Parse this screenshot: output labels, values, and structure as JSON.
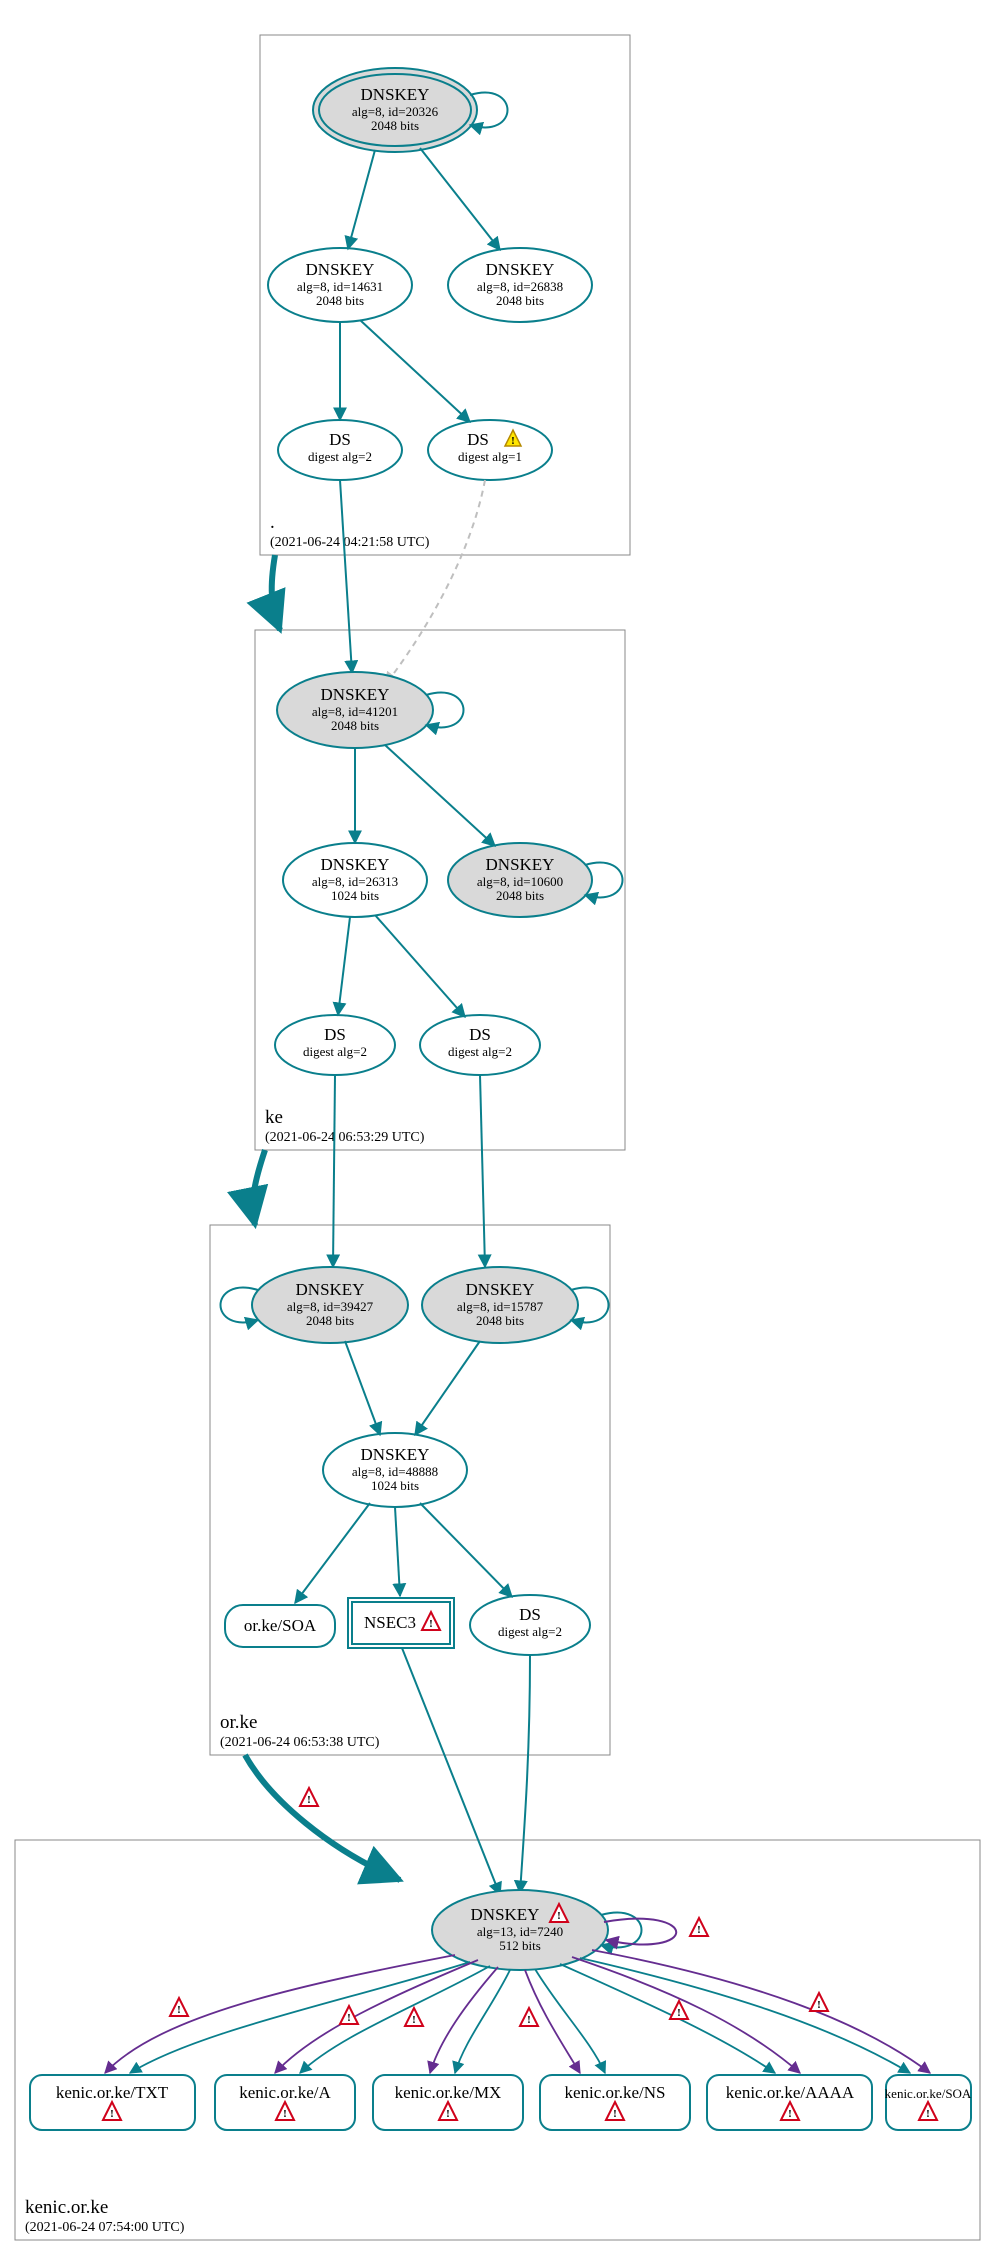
{
  "colors": {
    "teal": "#0a7f8c",
    "purple": "#652d90",
    "grayFill": "#d9d9d9",
    "lightGray": "#bfbfbf",
    "warnFill": "#ffe600",
    "warnStroke": "#b58900",
    "errStroke": "#d0021b",
    "boxStroke": "#888888"
  },
  "zones": {
    "root": {
      "label": ".",
      "time": "(2021-06-24 04:21:58 UTC)"
    },
    "ke": {
      "label": "ke",
      "time": "(2021-06-24 06:53:29 UTC)"
    },
    "orke": {
      "label": "or.ke",
      "time": "(2021-06-24 06:53:38 UTC)"
    },
    "kenic": {
      "label": "kenic.or.ke",
      "time": "(2021-06-24 07:54:00 UTC)"
    }
  },
  "nodes": {
    "root_ksk": {
      "t": "DNSKEY",
      "l1": "alg=8, id=20326",
      "l2": "2048 bits"
    },
    "root_zsk1": {
      "t": "DNSKEY",
      "l1": "alg=8, id=14631",
      "l2": "2048 bits"
    },
    "root_zsk2": {
      "t": "DNSKEY",
      "l1": "alg=8, id=26838",
      "l2": "2048 bits"
    },
    "root_ds1": {
      "t": "DS",
      "l1": "digest alg=2"
    },
    "root_ds2": {
      "t": "DS",
      "l1": "digest alg=1"
    },
    "ke_ksk": {
      "t": "DNSKEY",
      "l1": "alg=8, id=41201",
      "l2": "2048 bits"
    },
    "ke_zsk": {
      "t": "DNSKEY",
      "l1": "alg=8, id=26313",
      "l2": "1024 bits"
    },
    "ke_key2": {
      "t": "DNSKEY",
      "l1": "alg=8, id=10600",
      "l2": "2048 bits"
    },
    "ke_ds1": {
      "t": "DS",
      "l1": "digest alg=2"
    },
    "ke_ds2": {
      "t": "DS",
      "l1": "digest alg=2"
    },
    "orke_ksk1": {
      "t": "DNSKEY",
      "l1": "alg=8, id=39427",
      "l2": "2048 bits"
    },
    "orke_ksk2": {
      "t": "DNSKEY",
      "l1": "alg=8, id=15787",
      "l2": "2048 bits"
    },
    "orke_zsk": {
      "t": "DNSKEY",
      "l1": "alg=8, id=48888",
      "l2": "1024 bits"
    },
    "orke_soa": {
      "t": "or.ke/SOA"
    },
    "orke_nsec3": {
      "t": "NSEC3"
    },
    "orke_ds": {
      "t": "DS",
      "l1": "digest alg=2"
    },
    "kenic_key": {
      "t": "DNSKEY",
      "l1": "alg=13, id=7240",
      "l2": "512 bits"
    },
    "rr_txt": {
      "t": "kenic.or.ke/TXT"
    },
    "rr_a": {
      "t": "kenic.or.ke/A"
    },
    "rr_mx": {
      "t": "kenic.or.ke/MX"
    },
    "rr_ns": {
      "t": "kenic.or.ke/NS"
    },
    "rr_aaaa": {
      "t": "kenic.or.ke/AAAA"
    },
    "rr_soa": {
      "t": "kenic.or.ke/SOA"
    }
  },
  "chart_data": {
    "type": "graph",
    "description": "DNSSEC authentication chain / DNSViz-style delegation graph",
    "zones": [
      {
        "name": ".",
        "timestamp": "2021-06-24 04:21:58 UTC"
      },
      {
        "name": "ke",
        "timestamp": "2021-06-24 06:53:29 UTC"
      },
      {
        "name": "or.ke",
        "timestamp": "2021-06-24 06:53:38 UTC"
      },
      {
        "name": "kenic.or.ke",
        "timestamp": "2021-06-24 07:54:00 UTC"
      }
    ],
    "nodes": [
      {
        "id": "root_ksk",
        "zone": ".",
        "type": "DNSKEY",
        "alg": 8,
        "key_id": 20326,
        "bits": 2048,
        "role": "KSK",
        "trust_anchor": true
      },
      {
        "id": "root_zsk1",
        "zone": ".",
        "type": "DNSKEY",
        "alg": 8,
        "key_id": 14631,
        "bits": 2048
      },
      {
        "id": "root_zsk2",
        "zone": ".",
        "type": "DNSKEY",
        "alg": 8,
        "key_id": 26838,
        "bits": 2048
      },
      {
        "id": "root_ds1",
        "zone": ".",
        "type": "DS",
        "digest_alg": 2
      },
      {
        "id": "root_ds2",
        "zone": ".",
        "type": "DS",
        "digest_alg": 1,
        "status": "warning"
      },
      {
        "id": "ke_ksk",
        "zone": "ke",
        "type": "DNSKEY",
        "alg": 8,
        "key_id": 41201,
        "bits": 2048,
        "role": "KSK"
      },
      {
        "id": "ke_zsk",
        "zone": "ke",
        "type": "DNSKEY",
        "alg": 8,
        "key_id": 26313,
        "bits": 1024
      },
      {
        "id": "ke_key2",
        "zone": "ke",
        "type": "DNSKEY",
        "alg": 8,
        "key_id": 10600,
        "bits": 2048
      },
      {
        "id": "ke_ds1",
        "zone": "ke",
        "type": "DS",
        "digest_alg": 2
      },
      {
        "id": "ke_ds2",
        "zone": "ke",
        "type": "DS",
        "digest_alg": 2
      },
      {
        "id": "orke_ksk1",
        "zone": "or.ke",
        "type": "DNSKEY",
        "alg": 8,
        "key_id": 39427,
        "bits": 2048,
        "role": "KSK"
      },
      {
        "id": "orke_ksk2",
        "zone": "or.ke",
        "type": "DNSKEY",
        "alg": 8,
        "key_id": 15787,
        "bits": 2048,
        "role": "KSK"
      },
      {
        "id": "orke_zsk",
        "zone": "or.ke",
        "type": "DNSKEY",
        "alg": 8,
        "key_id": 48888,
        "bits": 1024
      },
      {
        "id": "orke_soa",
        "zone": "or.ke",
        "type": "RRset",
        "name": "or.ke/SOA"
      },
      {
        "id": "orke_nsec3",
        "zone": "or.ke",
        "type": "NSEC3",
        "status": "error"
      },
      {
        "id": "orke_ds",
        "zone": "or.ke",
        "type": "DS",
        "digest_alg": 2
      },
      {
        "id": "kenic_key",
        "zone": "kenic.or.ke",
        "type": "DNSKEY",
        "alg": 13,
        "key_id": 7240,
        "bits": 512,
        "status": "error"
      },
      {
        "id": "rr_txt",
        "zone": "kenic.or.ke",
        "type": "RRset",
        "name": "kenic.or.ke/TXT",
        "status": "error"
      },
      {
        "id": "rr_a",
        "zone": "kenic.or.ke",
        "type": "RRset",
        "name": "kenic.or.ke/A",
        "status": "error"
      },
      {
        "id": "rr_mx",
        "zone": "kenic.or.ke",
        "type": "RRset",
        "name": "kenic.or.ke/MX",
        "status": "error"
      },
      {
        "id": "rr_ns",
        "zone": "kenic.or.ke",
        "type": "RRset",
        "name": "kenic.or.ke/NS",
        "status": "error"
      },
      {
        "id": "rr_aaaa",
        "zone": "kenic.or.ke",
        "type": "RRset",
        "name": "kenic.or.ke/AAAA",
        "status": "error"
      },
      {
        "id": "rr_soa",
        "zone": "kenic.or.ke",
        "type": "RRset",
        "name": "kenic.or.ke/SOA",
        "status": "error"
      }
    ],
    "edges": [
      {
        "from": "root_ksk",
        "to": "root_ksk",
        "kind": "self-sig"
      },
      {
        "from": "root_ksk",
        "to": "root_zsk1",
        "kind": "signs"
      },
      {
        "from": "root_ksk",
        "to": "root_zsk2",
        "kind": "signs"
      },
      {
        "from": "root_zsk1",
        "to": "root_ds1",
        "kind": "signs"
      },
      {
        "from": "root_zsk1",
        "to": "root_ds2",
        "kind": "signs"
      },
      {
        "from": "root_ds1",
        "to": "ke_ksk",
        "kind": "digest"
      },
      {
        "from": "root_ds2",
        "to": "ke_ksk",
        "kind": "digest",
        "style": "dashed"
      },
      {
        "from": ".",
        "to": "ke",
        "kind": "delegation"
      },
      {
        "from": "ke_ksk",
        "to": "ke_ksk",
        "kind": "self-sig"
      },
      {
        "from": "ke_ksk",
        "to": "ke_zsk",
        "kind": "signs"
      },
      {
        "from": "ke_ksk",
        "to": "ke_key2",
        "kind": "signs"
      },
      {
        "from": "ke_key2",
        "to": "ke_key2",
        "kind": "self-sig"
      },
      {
        "from": "ke_zsk",
        "to": "ke_ds1",
        "kind": "signs"
      },
      {
        "from": "ke_zsk",
        "to": "ke_ds2",
        "kind": "signs"
      },
      {
        "from": "ke_ds1",
        "to": "orke_ksk1",
        "kind": "digest"
      },
      {
        "from": "ke_ds2",
        "to": "orke_ksk2",
        "kind": "digest"
      },
      {
        "from": "ke",
        "to": "or.ke",
        "kind": "delegation"
      },
      {
        "from": "orke_ksk1",
        "to": "orke_ksk1",
        "kind": "self-sig"
      },
      {
        "from": "orke_ksk2",
        "to": "orke_ksk2",
        "kind": "self-sig"
      },
      {
        "from": "orke_ksk1",
        "to": "orke_zsk",
        "kind": "signs"
      },
      {
        "from": "orke_ksk2",
        "to": "orke_zsk",
        "kind": "signs"
      },
      {
        "from": "orke_zsk",
        "to": "orke_soa",
        "kind": "signs"
      },
      {
        "from": "orke_zsk",
        "to": "orke_nsec3",
        "kind": "signs"
      },
      {
        "from": "orke_zsk",
        "to": "orke_ds",
        "kind": "signs"
      },
      {
        "from": "orke_nsec3",
        "to": "kenic_key",
        "kind": "nsec"
      },
      {
        "from": "orke_ds",
        "to": "kenic_key",
        "kind": "digest"
      },
      {
        "from": "or.ke",
        "to": "kenic.or.ke",
        "kind": "delegation",
        "status": "error"
      },
      {
        "from": "kenic_key",
        "to": "kenic_key",
        "kind": "self-sig",
        "status": "error"
      },
      {
        "from": "kenic_key",
        "to": "rr_txt",
        "kind": "signs",
        "color": "teal"
      },
      {
        "from": "kenic_key",
        "to": "rr_txt",
        "kind": "signs",
        "color": "purple",
        "status": "error"
      },
      {
        "from": "kenic_key",
        "to": "rr_a",
        "kind": "signs",
        "color": "teal"
      },
      {
        "from": "kenic_key",
        "to": "rr_a",
        "kind": "signs",
        "color": "purple",
        "status": "error"
      },
      {
        "from": "kenic_key",
        "to": "rr_mx",
        "kind": "signs",
        "color": "teal"
      },
      {
        "from": "kenic_key",
        "to": "rr_mx",
        "kind": "signs",
        "color": "purple",
        "status": "error"
      },
      {
        "from": "kenic_key",
        "to": "rr_ns",
        "kind": "signs",
        "color": "teal"
      },
      {
        "from": "kenic_key",
        "to": "rr_ns",
        "kind": "signs",
        "color": "purple",
        "status": "error"
      },
      {
        "from": "kenic_key",
        "to": "rr_aaaa",
        "kind": "signs",
        "color": "teal"
      },
      {
        "from": "kenic_key",
        "to": "rr_aaaa",
        "kind": "signs",
        "color": "purple",
        "status": "error"
      },
      {
        "from": "kenic_key",
        "to": "rr_soa",
        "kind": "signs",
        "color": "teal"
      },
      {
        "from": "kenic_key",
        "to": "rr_soa",
        "kind": "signs",
        "color": "purple",
        "status": "error"
      }
    ]
  }
}
